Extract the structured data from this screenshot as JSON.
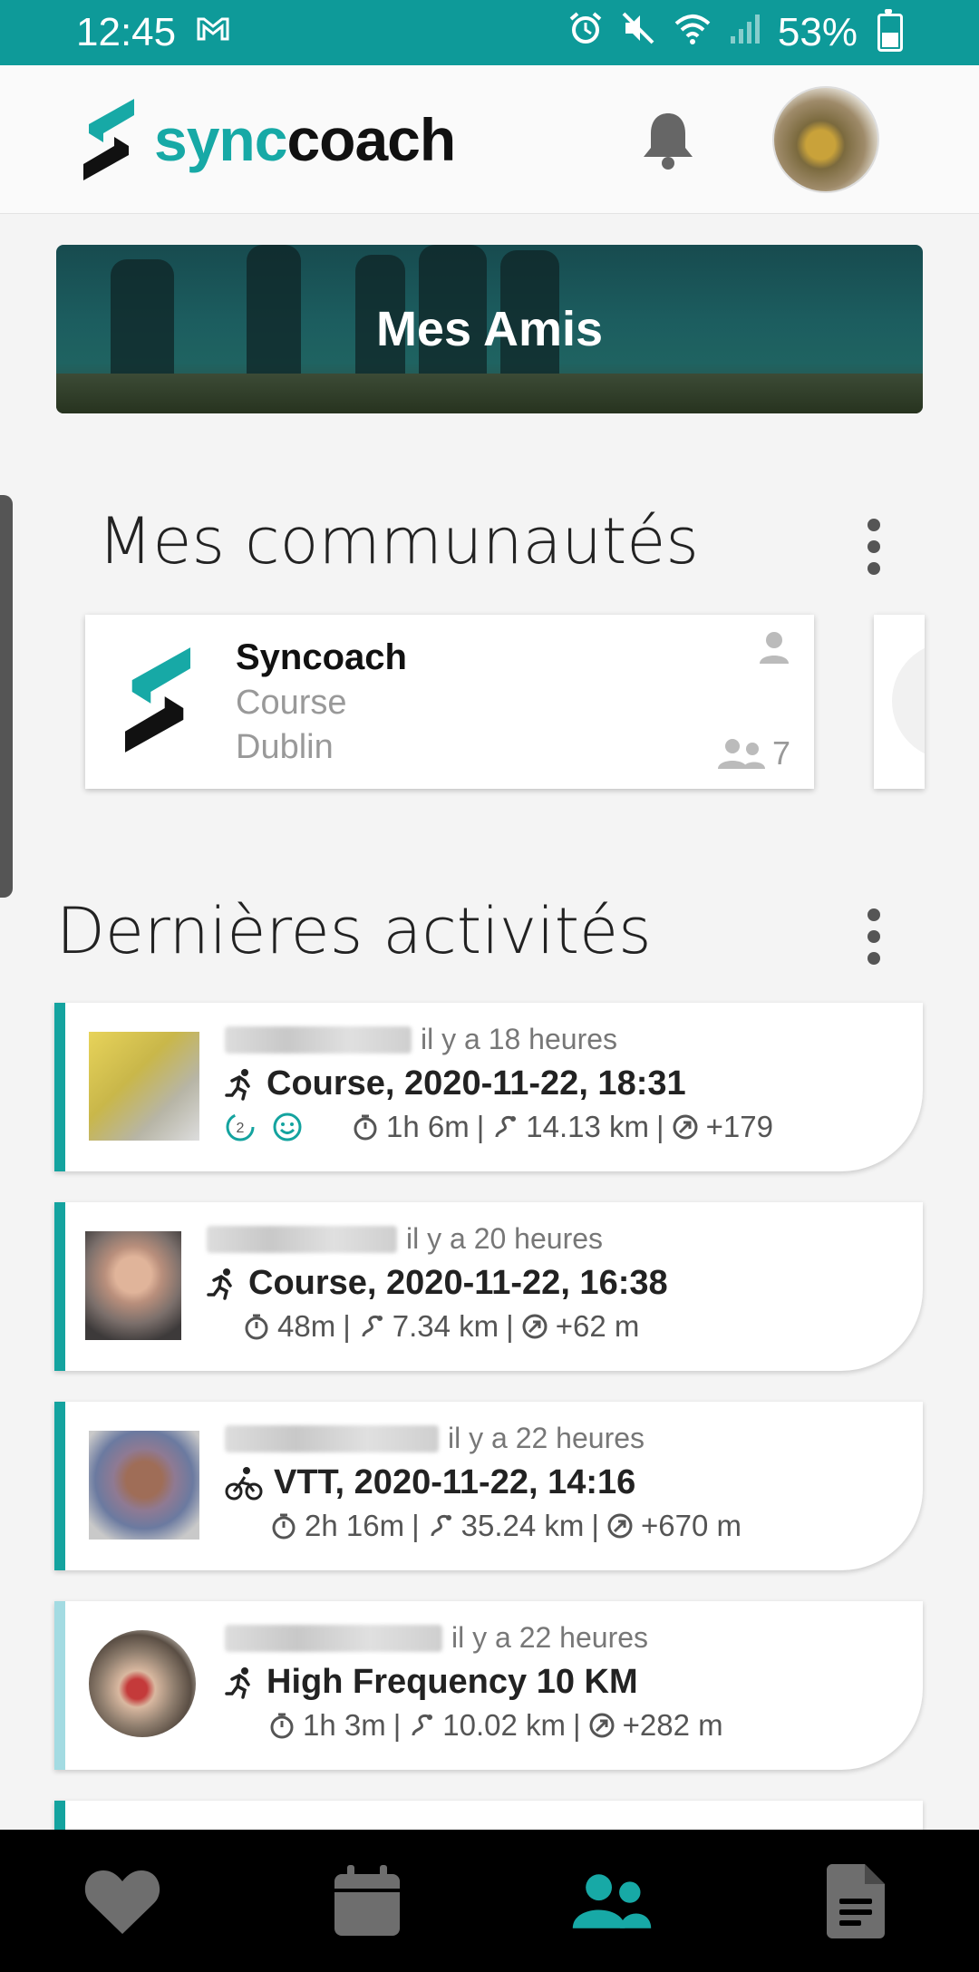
{
  "status_bar": {
    "time": "12:45",
    "battery": "53%"
  },
  "header": {
    "brand_sync": "sync",
    "brand_coach": "coach"
  },
  "banner": {
    "title": "Mes Amis"
  },
  "communities": {
    "title": "Mes communautés",
    "items": [
      {
        "name": "Syncoach",
        "sport": "Course",
        "city": "Dublin",
        "members": "7"
      }
    ]
  },
  "activities": {
    "title": "Dernières activités",
    "items": [
      {
        "time_ago": "il y a 18 heures",
        "title": "Course, 2020-11-22, 18:31",
        "duration": "1h 6m",
        "distance": "14.13 km",
        "elevation": "+179"
      },
      {
        "time_ago": "il y a 20 heures",
        "title": "Course, 2020-11-22, 16:38",
        "duration": "48m",
        "distance": "7.34 km",
        "elevation": "+62 m"
      },
      {
        "time_ago": "il y a 22 heures",
        "title": "VTT, 2020-11-22, 14:16",
        "duration": "2h 16m",
        "distance": "35.24 km",
        "elevation": "+670 m"
      },
      {
        "time_ago": "il y a 22 heures",
        "title": "High Frequency 10 KM",
        "duration": "1h 3m",
        "distance": "10.02 km",
        "elevation": "+282 m"
      }
    ]
  },
  "colors": {
    "accent": "#14a39f",
    "status_bar": "#0e9a99",
    "nav_active": "#17a9a6"
  },
  "nav": [
    "heart-icon",
    "calendar-icon",
    "friends-icon",
    "document-icon"
  ]
}
